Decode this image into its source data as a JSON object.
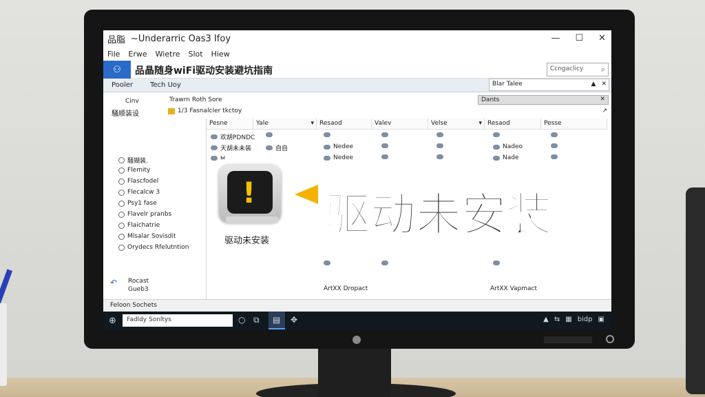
{
  "window": {
    "title_app": "品脂",
    "title_text": "~Underarric Oas3 Ifoy",
    "controls": [
      "—",
      "☐",
      "✕"
    ]
  },
  "menu": [
    "File",
    "Erwe",
    "Wietre",
    "Slot",
    "Hiew"
  ],
  "header": {
    "icon_name": "app-logo-icon",
    "title": "品晶随身wiFi驱动安装避坑指南",
    "search_placeholder": "Ccngaclicy",
    "search_icon": "search-icon"
  },
  "ribbon": {
    "tabs": [
      "Pooler",
      "Tech Uoy"
    ],
    "address": "Blar Talee",
    "address_controls": [
      "▲",
      "✕"
    ]
  },
  "nav": {
    "top1": "Cinv",
    "top2": "騒顺装设",
    "items": [
      "騒猢装.",
      "Flemity",
      "Flascfodel",
      "Flecalcw 3",
      "Psy1 fase",
      "Flavelr pranbs",
      "Flaichatrie",
      "Mlsalar Sovisdit",
      "Orydecs Rfelutntion"
    ],
    "bottom": [
      "Rocast",
      "Gueb3"
    ]
  },
  "pathbar": {
    "line1": "Trawrn Roth Sore",
    "line2": "1/3 Fasnalcler tkctoy",
    "combo": "Dants",
    "combo_close": "✕"
  },
  "columns": [
    "Pesne",
    "Yale",
    "Resaod",
    "Valev",
    "Velse",
    "Resaod",
    "Pesse"
  ],
  "rows": {
    "col1": [
      "欢胡PDNDC",
      "天胡未未装",
      "ы"
    ],
    "col2": [
      "",
      "自自"
    ],
    "col3": [
      "",
      "Nedee",
      "Nedee"
    ],
    "col6": [
      "",
      "Nadeo",
      "Nade"
    ],
    "bottom_left": "ArtXX Dropact",
    "bottom_right": "ArtXX Vapmact"
  },
  "device": {
    "caption": "驱动未安装",
    "icon_name": "warning-device-icon"
  },
  "overlay": {
    "text": "驱动未安装"
  },
  "status": "Feloon Sochets",
  "taskbar": {
    "search": "Fadldy Sonltys",
    "tray": [
      "▲",
      "⇆",
      "▦",
      "bidp",
      "▣"
    ]
  },
  "colors": {
    "accent": "#2a6bc7",
    "warning": "#f3b300",
    "taskbar": "#101820"
  }
}
